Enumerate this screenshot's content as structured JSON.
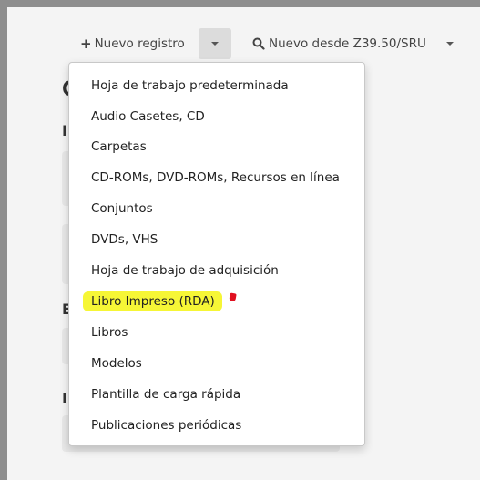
{
  "toolbar": {
    "new_record_label": "Nuevo registro",
    "z3950_label": "Nuevo desde Z39.50/SRU"
  },
  "dropdown": {
    "items": [
      "Hoja de trabajo predeterminada",
      "Audio Casetes, CD",
      "Carpetas",
      "CD-ROMs, DVD-ROMs, Recursos en línea",
      "Conjuntos",
      "DVDs, VHS",
      "Hoja de trabajo de adquisición",
      "Libro Impreso (RDA)",
      "Libros",
      "Modelos",
      "Plantilla de carga rápida",
      "Publicaciones periódicas"
    ]
  },
  "colors": {
    "highlight": "#f6f636",
    "annotation_mark": "#e01020"
  }
}
